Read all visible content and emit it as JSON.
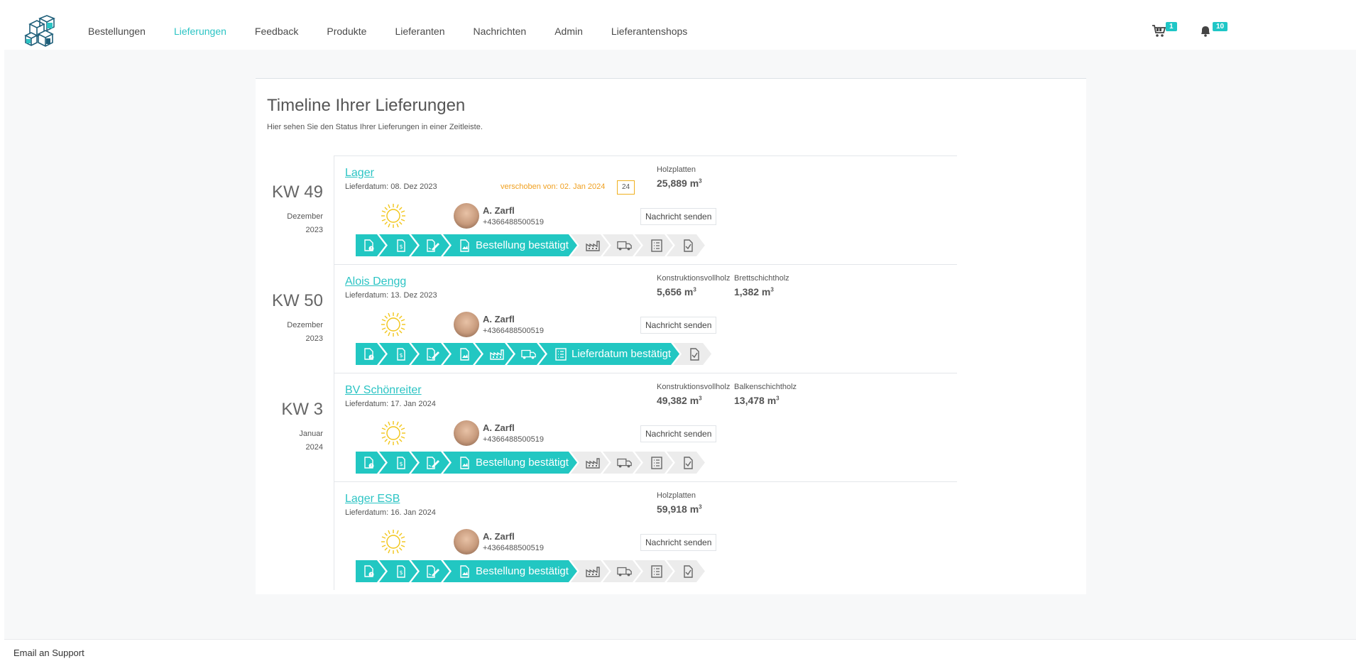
{
  "nav": {
    "links": [
      "Bestellungen",
      "Lieferungen",
      "Feedback",
      "Produkte",
      "Lieferanten",
      "Nachrichten",
      "Admin",
      "Lieferantenshops"
    ],
    "active": "Lieferungen",
    "cart_badge": "1",
    "bell_badge": "10"
  },
  "page": {
    "title": "Timeline Ihrer Lieferungen",
    "subtitle": "Hier sehen Sie den Status Ihrer Lieferungen in einer Zeitleiste."
  },
  "deliveries": [
    {
      "kw": "KW 49",
      "month": "Dezember",
      "year": "2023",
      "site": "Lager",
      "date": "Lieferdatum: 08. Dez 2023",
      "shift_note": "verschoben von: 02. Jan 2024",
      "shift_box": "24",
      "products": [
        {
          "name": "Holzplatten",
          "value": "25,889 m"
        }
      ],
      "contact_name": "A. Zarfl",
      "contact_phone": "+4366488500519",
      "message_button": "Nachricht senden",
      "step_label": "Bestellung bestätigt",
      "active_step": 3
    },
    {
      "kw": "KW 50",
      "month": "Dezember",
      "year": "2023",
      "site": "Alois Dengg",
      "date": "Lieferdatum: 13. Dez 2023",
      "products": [
        {
          "name": "Konstruktionsvollholz",
          "value": "5,656 m"
        },
        {
          "name": "Brettschichtholz",
          "value": "1,382 m"
        }
      ],
      "contact_name": "A. Zarfl",
      "contact_phone": "+4366488500519",
      "message_button": "Nachricht senden",
      "step_label": "Lieferdatum bestätigt",
      "active_step": 6
    },
    {
      "kw": "KW 3",
      "month": "Januar",
      "year": "2024",
      "site": "BV Schönreiter",
      "date": "Lieferdatum: 17. Jan 2024",
      "products": [
        {
          "name": "Konstruktionsvollholz",
          "value": "49,382 m"
        },
        {
          "name": "Balkenschichtholz",
          "value": "13,478 m"
        }
      ],
      "contact_name": "A. Zarfl",
      "contact_phone": "+4366488500519",
      "message_button": "Nachricht senden",
      "step_label": "Bestellung bestätigt",
      "active_step": 3
    },
    {
      "site": "Lager ESB",
      "date": "Lieferdatum: 16. Jan 2024",
      "products": [
        {
          "name": "Holzplatten",
          "value": "59,918 m"
        }
      ],
      "contact_name": "A. Zarfl",
      "contact_phone": "+4366488500519",
      "message_button": "Nachricht senden",
      "step_label": "Bestellung bestätigt",
      "active_step": 3
    }
  ],
  "steps_icons": [
    "document-question-icon",
    "document-price-icon",
    "document-sign-icon",
    "document-image-icon",
    "factory-icon",
    "truck-icon",
    "checklist-icon",
    "document-check-icon"
  ],
  "unit_sup": "3",
  "footer": {
    "support_link": "Email an Support"
  },
  "colors": {
    "accent": "#22c7c2",
    "shift": "#f0a020"
  }
}
